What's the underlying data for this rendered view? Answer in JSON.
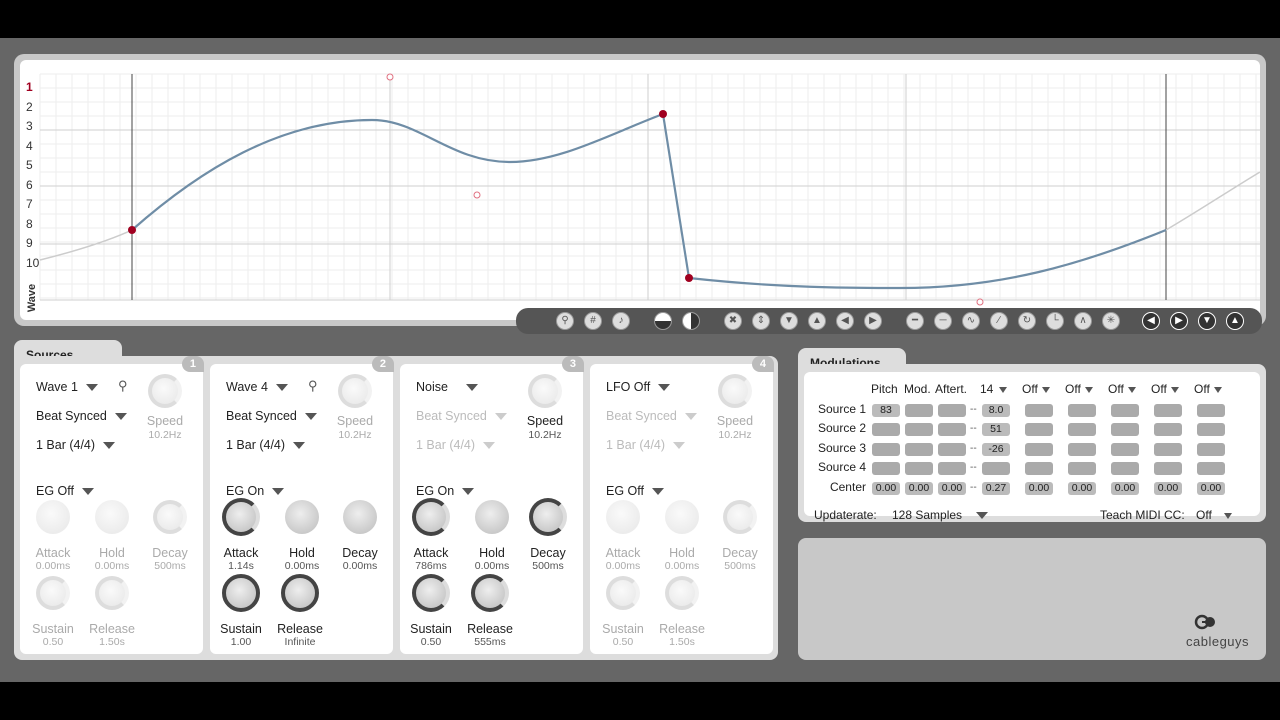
{
  "wave": {
    "label": "Wave",
    "numbers": [
      "1",
      "2",
      "3",
      "4",
      "5",
      "6",
      "7",
      "8",
      "9",
      "10"
    ],
    "selected": "1",
    "curve_color": "#6f8da6",
    "point_color": "#a00020"
  },
  "toolbar": {
    "icons": [
      "zoom-icon",
      "grid-icon",
      "note-icon",
      "half-left-icon",
      "half-right-icon",
      "shrink-icon",
      "expand-vertical-icon",
      "arrow-down-icon",
      "arrow-up-icon",
      "arrow-left-icon",
      "arrow-right-icon",
      "flat-low-icon",
      "flat-mid-icon",
      "sine-icon",
      "saw-icon",
      "ramp-icon",
      "step-icon",
      "triangle-icon",
      "random-icon",
      "rotate-left-icon",
      "rotate-right-icon",
      "flip-down-icon",
      "flip-up-icon"
    ]
  },
  "sources": {
    "title": "Sources",
    "panels": [
      {
        "num": "1",
        "wave": "Wave 1",
        "sync": "Beat Synced",
        "length": "1 Bar (4/4)",
        "speed_label": "Speed",
        "speed": "10.2Hz",
        "eg": "EG Off",
        "attack": "Attack",
        "attack_val": "0.00ms",
        "hold": "Hold",
        "hold_val": "0.00ms",
        "decay": "Decay",
        "decay_val": "500ms",
        "sustain": "Sustain",
        "sustain_val": "0.50",
        "release": "Release",
        "release_val": "1.50s"
      },
      {
        "num": "2",
        "wave": "Wave 4",
        "sync": "Beat Synced",
        "length": "1 Bar (4/4)",
        "speed_label": "Speed",
        "speed": "10.2Hz",
        "eg": "EG On",
        "attack": "Attack",
        "attack_val": "1.14s",
        "hold": "Hold",
        "hold_val": "0.00ms",
        "decay": "Decay",
        "decay_val": "0.00ms",
        "sustain": "Sustain",
        "sustain_val": "1.00",
        "release": "Release",
        "release_val": "Infinite"
      },
      {
        "num": "3",
        "wave": "Noise",
        "sync": "Beat Synced",
        "length": "1 Bar (4/4)",
        "speed_label": "Speed",
        "speed": "10.2Hz",
        "eg": "EG On",
        "attack": "Attack",
        "attack_val": "786ms",
        "hold": "Hold",
        "hold_val": "0.00ms",
        "decay": "Decay",
        "decay_val": "500ms",
        "sustain": "Sustain",
        "sustain_val": "0.50",
        "release": "Release",
        "release_val": "555ms"
      },
      {
        "num": "4",
        "wave": "LFO Off",
        "sync": "Beat Synced",
        "length": "1 Bar (4/4)",
        "speed_label": "Speed",
        "speed": "10.2Hz",
        "eg": "EG Off",
        "attack": "Attack",
        "attack_val": "0.00ms",
        "hold": "Hold",
        "hold_val": "0.00ms",
        "decay": "Decay",
        "decay_val": "500ms",
        "sustain": "Sustain",
        "sustain_val": "0.50",
        "release": "Release",
        "release_val": "1.50s"
      }
    ]
  },
  "modulations": {
    "title": "Modulations",
    "headers": {
      "pitch": "Pitch",
      "mod": "Mod.",
      "aftert": "Aftert.",
      "cc": "14",
      "off1": "Off",
      "off2": "Off",
      "off3": "Off",
      "off4": "Off",
      "off5": "Off"
    },
    "rows": [
      {
        "label": "Source 1",
        "pitch": "83",
        "cc": "8.0"
      },
      {
        "label": "Source 2",
        "pitch": "",
        "cc": "51"
      },
      {
        "label": "Source 3",
        "pitch": "",
        "cc": "-26"
      },
      {
        "label": "Source 4",
        "pitch": "",
        "cc": ""
      }
    ],
    "center_label": "Center",
    "center_values": [
      "0.00",
      "0.00",
      "0.00",
      "0.27",
      "0.00",
      "0.00",
      "0.00",
      "0.00",
      "0.00"
    ],
    "updaterate_label": "Updaterate:",
    "updaterate_value": "128 Samples",
    "teach_label": "Teach MIDI CC:",
    "teach_value": "Off"
  },
  "brand": {
    "name": "cableguys"
  }
}
